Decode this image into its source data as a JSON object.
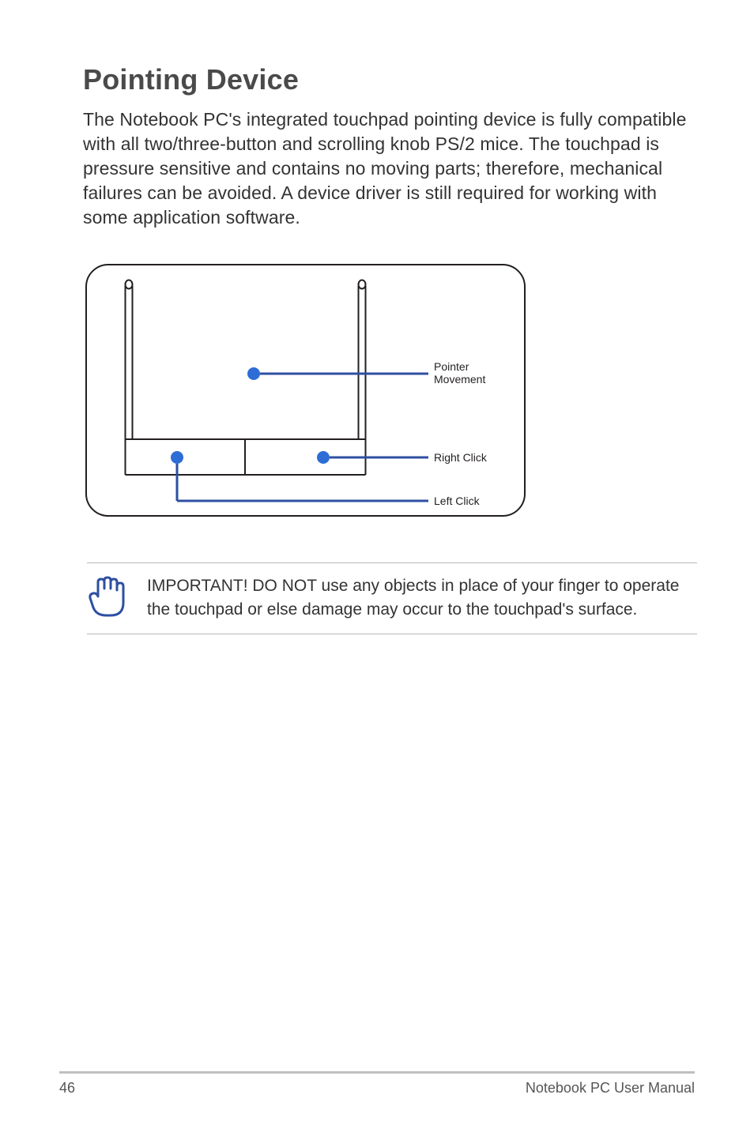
{
  "heading": "Pointing Device",
  "body_text": "The Notebook PC's integrated touchpad pointing device is fully compatible with all two/three-button and scrolling knob PS/2 mice. The touchpad is pressure sensitive and contains no moving parts; therefore, mechanical failures can be avoided. A device driver is still required for working with some application software.",
  "diagram": {
    "label_pointer_line1": "Pointer",
    "label_pointer_line2": "Movement",
    "label_right_click": "Right Click",
    "label_left_click": "Left Click"
  },
  "note_text": "IMPORTANT! DO NOT use any objects in place of your finger to operate the touchpad or else damage may occur to the touchpad's surface.",
  "footer": {
    "page_number": "46",
    "doc_title": "Notebook PC User Manual"
  },
  "colors": {
    "callout_blue": "#2e4fa2",
    "dot_blue": "#2e6dd6",
    "stroke_dark": "#231f20"
  }
}
